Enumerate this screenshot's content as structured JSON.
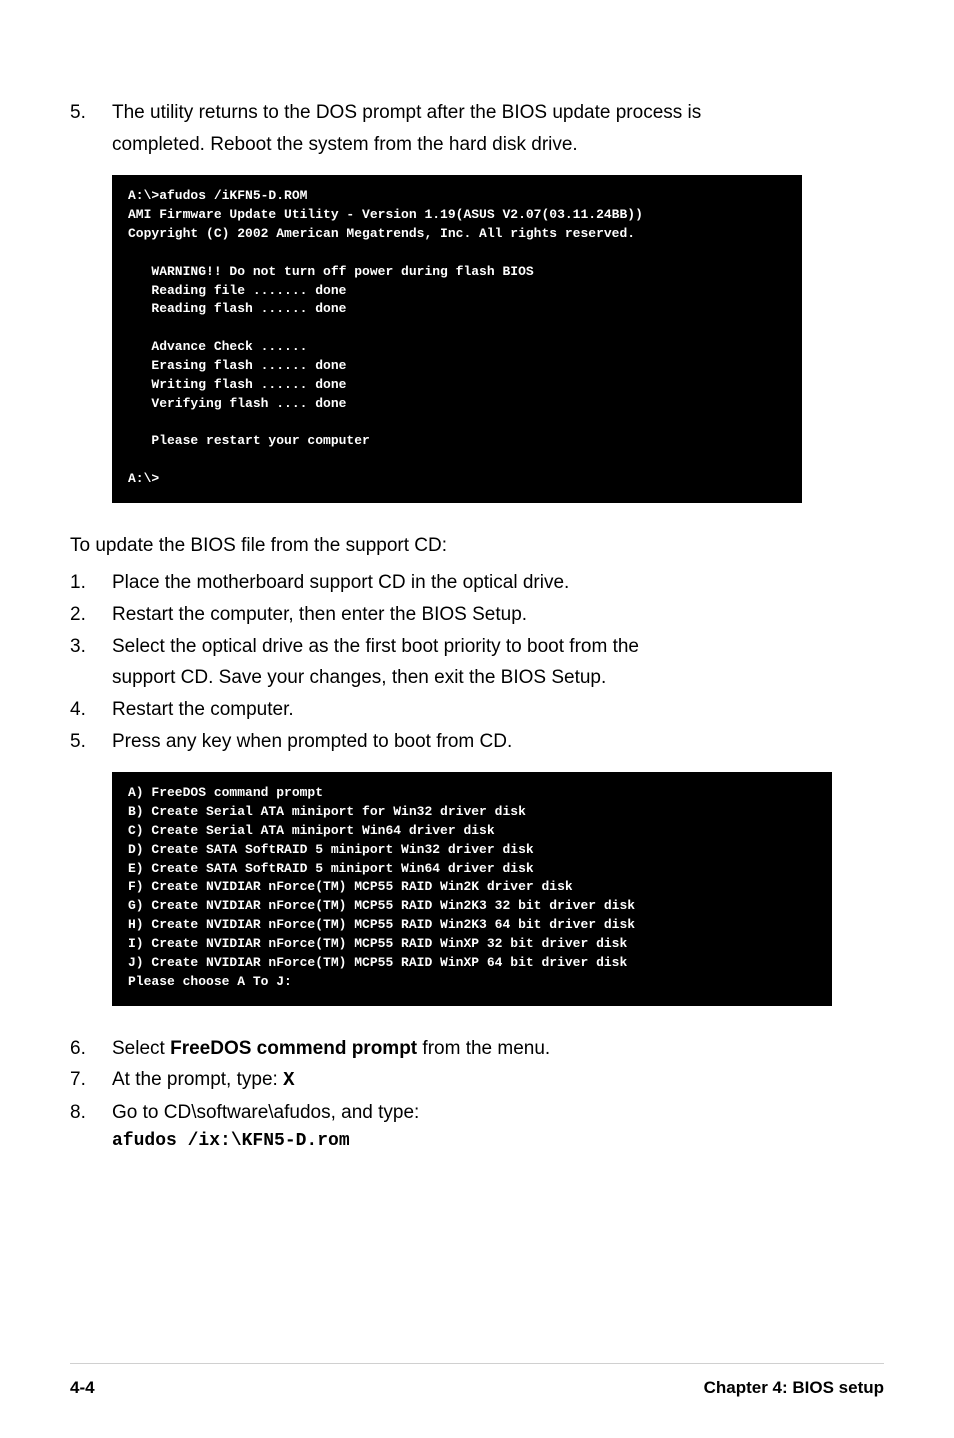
{
  "steps1": {
    "n5": "5.",
    "t5a": "The utility returns to the DOS prompt after the BIOS update process is",
    "t5b": "completed. Reboot the system from the hard disk drive."
  },
  "terminal1": "A:\\>afudos /iKFN5-D.ROM\nAMI Firmware Update Utility - Version 1.19(ASUS V2.07(03.11.24BB))\nCopyright (C) 2002 American Megatrends, Inc. All rights reserved.\n\n   WARNING!! Do not turn off power during flash BIOS\n   Reading file ....... done\n   Reading flash ...... done\n\n   Advance Check ......\n   Erasing flash ...... done\n   Writing flash ...... done\n   Verifying flash .... done\n\n   Please restart your computer\n\nA:\\>\n",
  "lead2": "To update the BIOS file from the support CD:",
  "steps2": {
    "n1": "1.",
    "t1": "Place the motherboard support CD in the optical drive.",
    "n2": "2.",
    "t2": "Restart the computer, then enter the BIOS Setup.",
    "n3": "3.",
    "t3a": "Select the optical drive as the first boot priority to boot from the",
    "t3b": "support CD. Save your changes, then exit the BIOS Setup.",
    "n4": "4.",
    "t4": "Restart the computer.",
    "n5": "5.",
    "t5": "Press any key when prompted to boot from CD."
  },
  "terminal2": "A) FreeDOS command prompt\nB) Create Serial ATA miniport for Win32 driver disk\nC) Create Serial ATA miniport Win64 driver disk\nD) Create SATA SoftRAID 5 miniport Win32 driver disk\nE) Create SATA SoftRAID 5 miniport Win64 driver disk\nF) Create NVIDIAR nForce(TM) MCP55 RAID Win2K driver disk\nG) Create NVIDIAR nForce(TM) MCP55 RAID Win2K3 32 bit driver disk\nH) Create NVIDIAR nForce(TM) MCP55 RAID Win2K3 64 bit driver disk\nI) Create NVIDIAR nForce(TM) MCP55 RAID WinXP 32 bit driver disk\nJ) Create NVIDIAR nForce(TM) MCP55 RAID WinXP 64 bit driver disk\nPlease choose A To J:\n",
  "steps3": {
    "n6": "6.",
    "t6a": "Select ",
    "t6b": "FreeDOS commend prompt",
    "t6c": " from the menu.",
    "n7": "7.",
    "t7a": "At the prompt, type: ",
    "t7b": "X",
    "n8": "8.",
    "t8": "Go to CD\\software\\afudos, and type:"
  },
  "cmd": "afudos /ix:\\KFN5-D.rom",
  "footer": {
    "left": "4-4",
    "right": "Chapter 4: BIOS setup"
  }
}
